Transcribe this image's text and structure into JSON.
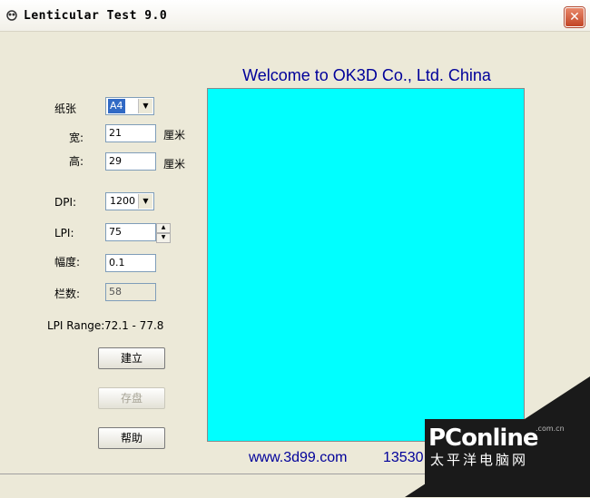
{
  "window": {
    "title": "Lenticular Test 9.0",
    "close_glyph": "✕",
    "icon": "app-logo-icon"
  },
  "form": {
    "paper_label": "纸张",
    "paper_value": "A4",
    "width_label": "宽:",
    "width_value": "21",
    "width_unit": "厘米",
    "height_label": "高:",
    "height_value": "29",
    "height_unit": "厘米",
    "dpi_label": "DPI:",
    "dpi_value": "1200",
    "lpi_label": "LPI:",
    "lpi_value": "75",
    "range_label": "幅度:",
    "range_value": "0.1",
    "columns_label": "栏数:",
    "columns_value": "58",
    "lpi_range_label": "LPI Range:",
    "lpi_range_value": "72.1 - 77.8"
  },
  "buttons": {
    "create": "建立",
    "save": "存盘",
    "help": "帮助"
  },
  "preview": {
    "welcome": "Welcome to OK3D Co., Ltd. China",
    "website": "www.3d99.com",
    "phone": "13530",
    "fill_color": "#00FFFF"
  },
  "watermark": {
    "brand": "PConline",
    "domain": ".com.cn",
    "chinese": "太平洋电脑网"
  }
}
